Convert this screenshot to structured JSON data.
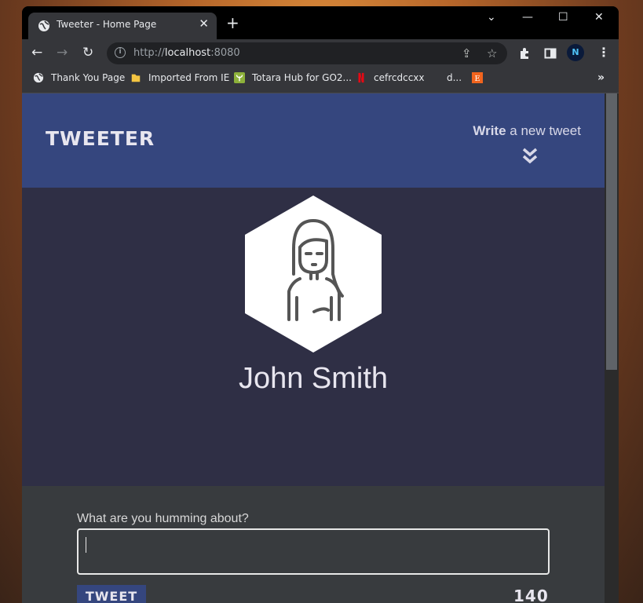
{
  "browser": {
    "tab": {
      "title": "Tweeter - Home Page",
      "close": "✕"
    },
    "new_tab": "+",
    "window_controls": {
      "dropdown": "⌄",
      "minimize": "—",
      "maximize": "☐",
      "close": "✕"
    },
    "address": {
      "scheme": "http://",
      "host": "localhost",
      "port": ":8080"
    },
    "bookmarks": [
      {
        "label": "Thank You Page",
        "icon": "globe-icon"
      },
      {
        "label": "Imported From IE",
        "icon": "folder-icon"
      },
      {
        "label": "Totara Hub for GO2...",
        "icon": "totara-icon"
      },
      {
        "label": "cefrcdccxx",
        "icon": "netflix-icon"
      },
      {
        "label": "d...",
        "icon": "blank-icon"
      },
      {
        "label": "",
        "icon": "etsy-icon"
      }
    ],
    "bookmarks_more": "»",
    "profile_initial": "N"
  },
  "page": {
    "brand": "TWEETER",
    "write_bold": "Write",
    "write_rest": " a new tweet",
    "user_name": "John Smith",
    "compose_prompt": "What are you humming about?",
    "tweet_button": "TWEET",
    "char_counter": "140"
  },
  "colors": {
    "header_bg": "#35467e",
    "profile_bg": "#2f2f45",
    "compose_bg": "#383b3e"
  }
}
